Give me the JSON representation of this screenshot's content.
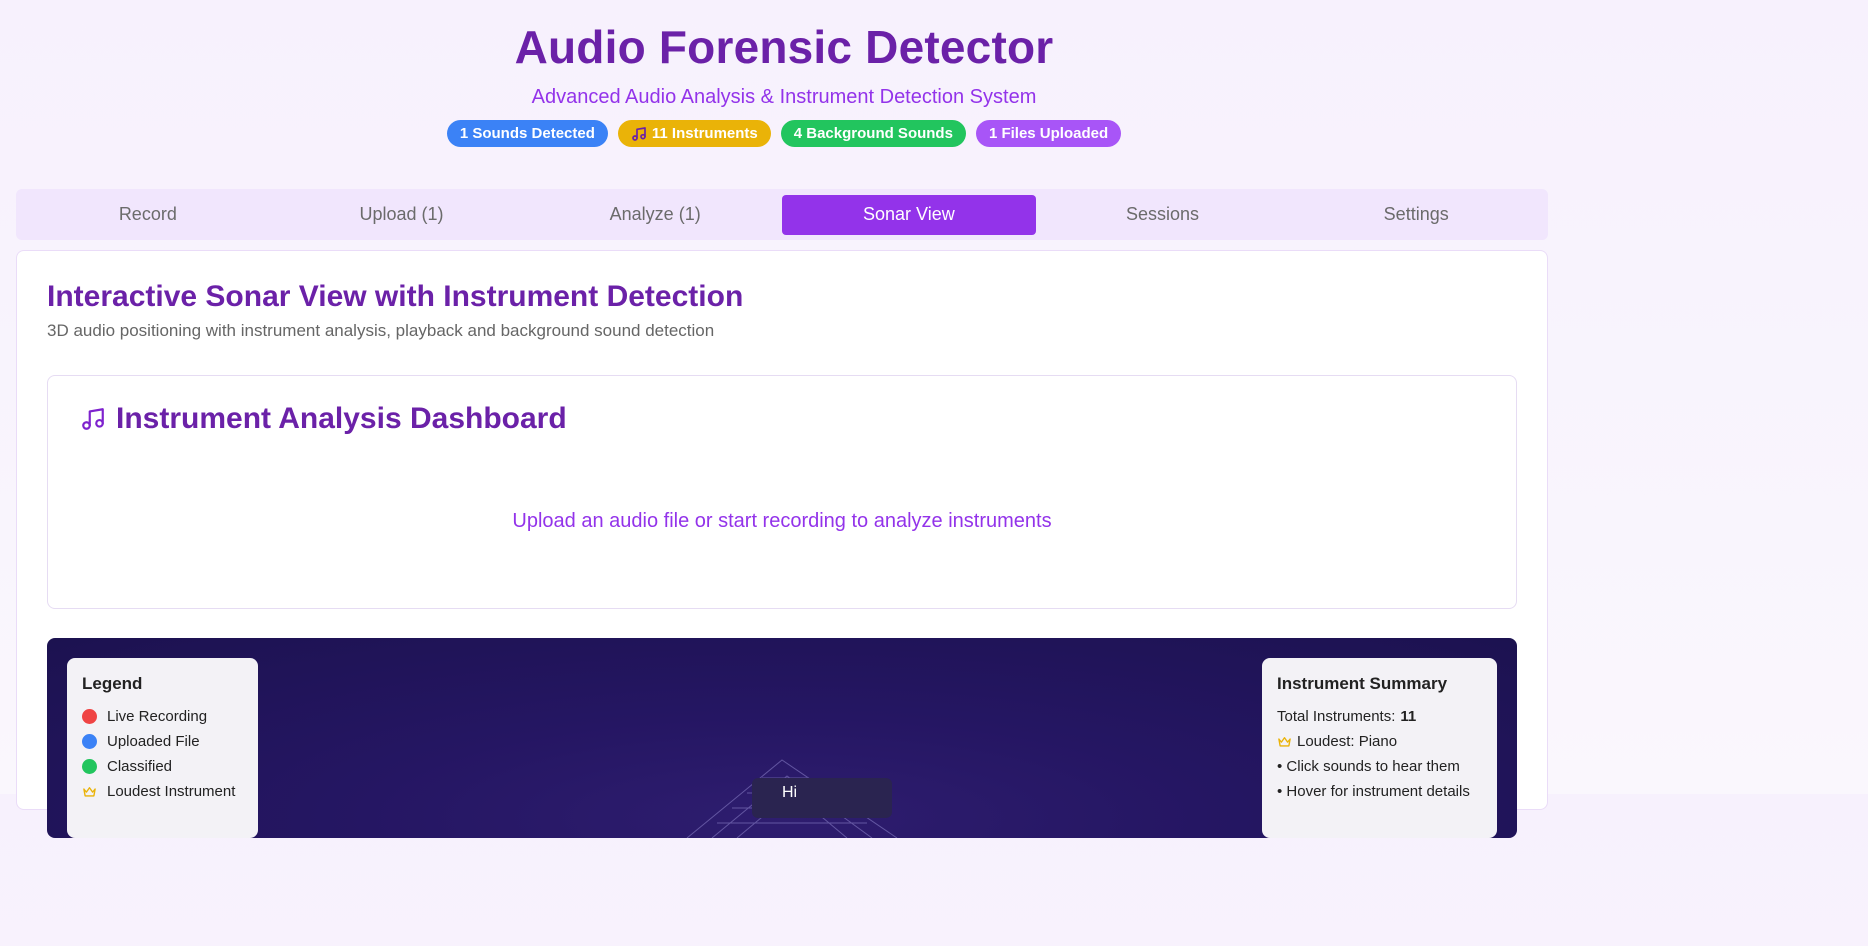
{
  "header": {
    "title": "Audio Forensic Detector",
    "subtitle": "Advanced Audio Analysis & Instrument Detection System"
  },
  "badges": {
    "sounds": "1 Sounds Detected",
    "instruments": "11 Instruments",
    "background": "4 Background Sounds",
    "files": "1 Files Uploaded"
  },
  "tabs": [
    "Record",
    "Upload (1)",
    "Analyze (1)",
    "Sonar View",
    "Sessions",
    "Settings"
  ],
  "active_tab": "Sonar View",
  "panel": {
    "title": "Interactive Sonar View with Instrument Detection",
    "description": "3D audio positioning with instrument analysis, playback and background sound detection"
  },
  "dashboard": {
    "title": "Instrument Analysis Dashboard",
    "empty_message": "Upload an audio file or start recording to analyze instruments"
  },
  "legend": {
    "title": "Legend",
    "items": [
      {
        "label": "Live Recording",
        "color": "#ef4444"
      },
      {
        "label": "Uploaded File",
        "color": "#3b82f6"
      },
      {
        "label": "Classified",
        "color": "#22c55e"
      },
      {
        "label": "Loudest Instrument",
        "icon": "crown-icon",
        "color": "#eab308"
      }
    ]
  },
  "summary": {
    "title": "Instrument Summary",
    "total_label": "Total Instruments:",
    "total_value": "11",
    "loudest": "Loudest: Piano",
    "hint_click": "• Click sounds to hear them",
    "hint_hover": "• Hover for instrument details"
  },
  "sonar_tooltip": "Hi"
}
